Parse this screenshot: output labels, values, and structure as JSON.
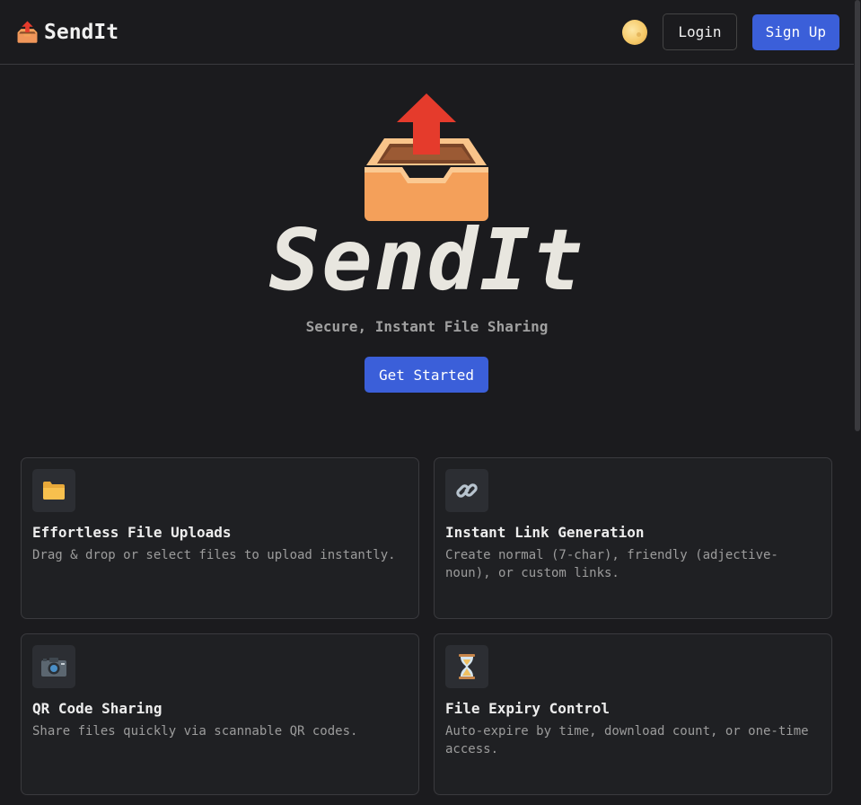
{
  "navbar": {
    "brand_name": "SendIt",
    "login_label": "Login",
    "signup_label": "Sign Up"
  },
  "hero": {
    "title": "SendIt",
    "subtitle": "Secure, Instant File Sharing",
    "cta_label": "Get Started"
  },
  "features": [
    {
      "icon": "folder-icon",
      "title": "Effortless File Uploads",
      "description": "Drag & drop or select files to upload instantly."
    },
    {
      "icon": "link-icon",
      "title": "Instant Link Generation",
      "description": "Create normal (7-char), friendly (adjective-noun), or custom links."
    },
    {
      "icon": "camera-icon",
      "title": "QR Code Sharing",
      "description": "Share files quickly via scannable QR codes."
    },
    {
      "icon": "hourglass-icon",
      "title": "File Expiry Control",
      "description": "Auto-expire by time, download count, or one-time access."
    }
  ],
  "colors": {
    "background": "#1b1b1e",
    "accent": "#3b5fd9",
    "card_background": "#1f2023"
  }
}
